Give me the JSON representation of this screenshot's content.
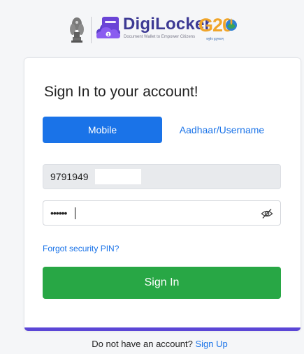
{
  "brand": {
    "app_name": "DigiLocker",
    "tagline": "Document Wallet to Empower Citizens",
    "g20_text": "G20",
    "g20_tagline": "वसुधैव कुटुम्बकम्",
    "brand_color": "#3d3a94",
    "g20_color": "#f0a52a"
  },
  "login": {
    "heading": "Sign In to your account!",
    "tabs": [
      {
        "label": "Mobile",
        "active": true
      },
      {
        "label": "Aadhaar/Username",
        "active": false
      }
    ],
    "mobile_value": "9791949",
    "pin_value": "••••••",
    "forgot_link": "Forgot security PIN?",
    "signin_label": "Sign In",
    "accent_color": "#1a73e8",
    "button_color": "#28a745"
  },
  "footer": {
    "prompt": "Do not have an account?",
    "signup_label": "Sign Up"
  },
  "icons": {
    "emblem": "national-emblem-icon",
    "locker": "digilocker-logo-icon",
    "eye": "eye-slash-icon"
  }
}
